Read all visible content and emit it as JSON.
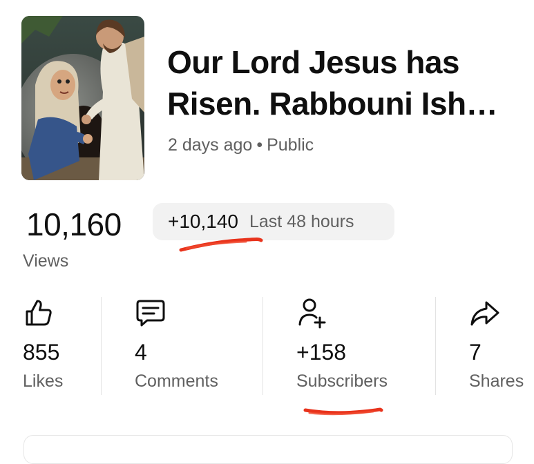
{
  "video": {
    "title": "Our Lord Jesus has Risen. Rabbouni Ish…",
    "posted": "2 days ago",
    "separator": "•",
    "visibility": "Public"
  },
  "views": {
    "count": "10,160",
    "label": "Views",
    "delta": "+10,140",
    "delta_period": "Last 48 hours"
  },
  "stats": [
    {
      "icon": "thumbs-up-icon",
      "value": "855",
      "label": "Likes"
    },
    {
      "icon": "comment-icon",
      "value": "4",
      "label": "Comments"
    },
    {
      "icon": "add-person-icon",
      "value": "+158",
      "label": "Subscribers"
    },
    {
      "icon": "share-arrow-icon",
      "value": "7",
      "label": "Shares"
    }
  ],
  "colors": {
    "text_primary": "#0f0f0f",
    "text_secondary": "#606060",
    "chip_background": "#f2f2f2",
    "annotation_red": "#e8331c"
  }
}
